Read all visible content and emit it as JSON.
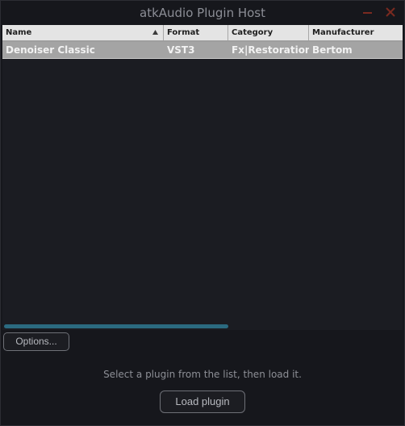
{
  "window": {
    "title": "atkAudio Plugin Host"
  },
  "icons": {
    "minimize": "minimize-icon",
    "close": "close-icon",
    "sort": "sort-ascending-icon"
  },
  "colors": {
    "titlebar_button": "#7a2a20",
    "scroll_thumb": "#2b6a80",
    "selected_row": "#a4a4a4"
  },
  "table": {
    "columns": [
      "Name",
      "Format",
      "Category",
      "Manufacturer"
    ],
    "rows": [
      {
        "name": "Denoiser Classic",
        "format": "VST3",
        "category": "Fx|Restoration",
        "manufacturer": "Bertom",
        "selected": true
      }
    ]
  },
  "footer": {
    "options_label": "Options...",
    "status": "Select a plugin from the list, then load it.",
    "load_label": "Load plugin"
  }
}
